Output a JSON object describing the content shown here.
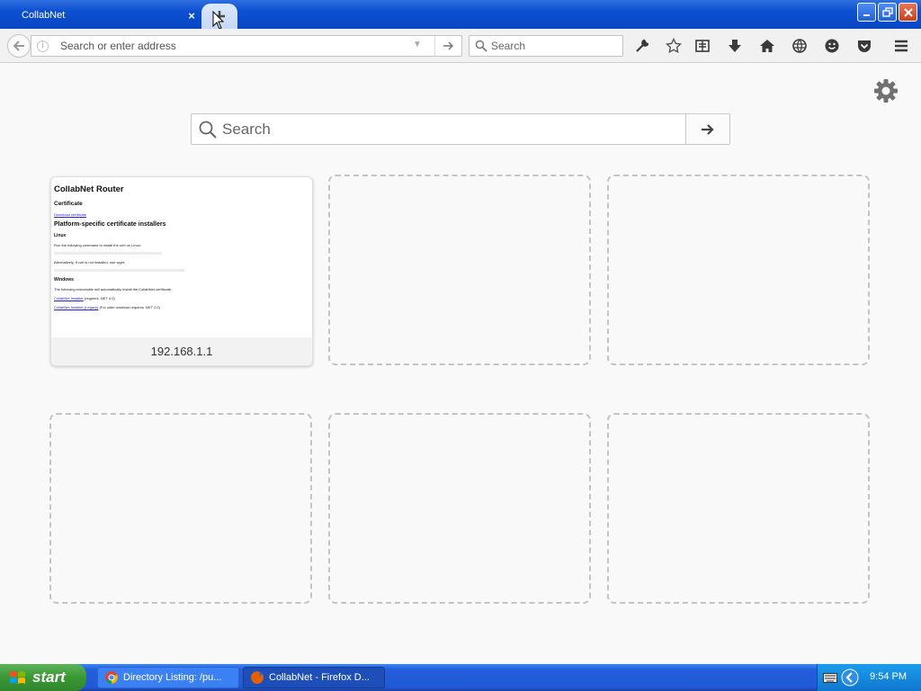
{
  "browser": {
    "tab": {
      "title": "CollabNet",
      "close_glyph": "×"
    },
    "window_controls": [
      "minimize-icon",
      "restore-icon",
      "close-icon"
    ],
    "urlbar": {
      "placeholder": "Search or enter address",
      "value": ""
    },
    "searchbar": {
      "placeholder": "Search",
      "value": ""
    },
    "toolbar_icons": [
      "wrench-icon",
      "bookmark-star-icon",
      "reading-list-icon",
      "download-icon",
      "home-icon",
      "globe-icon",
      "smiley-icon",
      "pocket-icon",
      "menu-icon"
    ]
  },
  "newtab": {
    "search": {
      "placeholder": "Search",
      "value": ""
    },
    "tiles": [
      {
        "caption": "192.168.1.1",
        "thumbnail": {
          "heading": "CollabNet Router",
          "certificate_heading": "Certificate",
          "certificate_link": "Download certificate",
          "platform_heading": "Platform-specific certificate installers",
          "linux_heading": "Linux",
          "linux_text": "Run the following command to install the cert on Linux:",
          "alt_text": "Alternatively, if curl is not installed, use wget:",
          "windows_heading": "Windows",
          "windows_text": "The following executable will automatically install the CollabNet certificate.",
          "installer_link": "CollabNet Installer",
          "installer_note": "(requires .NET 4.0)",
          "legacy_link": "CollabNet Installer (Legacy)",
          "legacy_note": "(For older windows requires .NET 2.0)"
        }
      },
      {
        "caption": ""
      },
      {
        "caption": ""
      },
      {
        "caption": ""
      },
      {
        "caption": ""
      },
      {
        "caption": ""
      }
    ]
  },
  "taskbar": {
    "start_label": "start",
    "tasks": [
      {
        "label": "Directory Listing: /pu...",
        "active": false,
        "icon": "chrome-icon"
      },
      {
        "label": "CollabNet - Firefox D...",
        "active": true,
        "icon": "firefox-icon"
      }
    ],
    "clock": "9:54 PM"
  }
}
